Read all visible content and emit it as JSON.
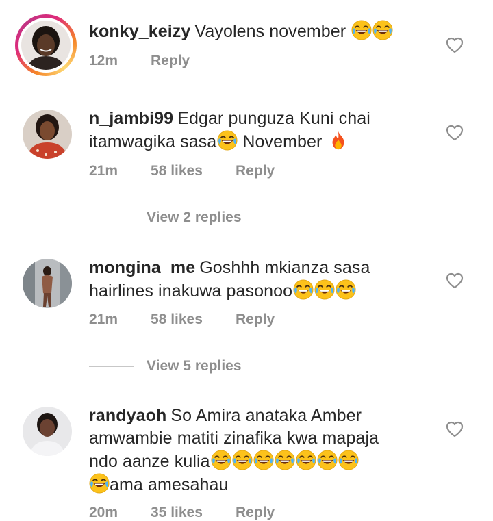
{
  "comments": [
    {
      "username": "konky_keizy",
      "text": "Vayolens november",
      "time": "12m",
      "likes": "",
      "reply_label": "Reply",
      "has_story": true
    },
    {
      "username": "n_jambi99",
      "text_line1": "Edgar punguza Kuni chai",
      "text_line2a": "itamwagika sasa",
      "text_line2b": "November",
      "time": "21m",
      "likes": "58 likes",
      "reply_label": "Reply",
      "view_replies": "View 2 replies"
    },
    {
      "username": "mongina_me",
      "text_line1": "Goshhh mkianza sasa",
      "text_line2": "hairlines inakuwa pasonoo",
      "time": "21m",
      "likes": "58 likes",
      "reply_label": "Reply",
      "view_replies": "View 5 replies"
    },
    {
      "username": "randyaoh",
      "text_line1": "So Amira anataka Amber",
      "text_line2": "amwambie matiti zinafika kwa mapaja",
      "text_line3": "ndo aanze kulia",
      "text_line4": "ama amesahau",
      "time": "20m",
      "likes": "35 likes",
      "reply_label": "Reply"
    }
  ],
  "icons": {
    "like": "heart-outline-icon",
    "laugh": "face-with-tears-of-joy-emoji",
    "fire": "fire-emoji"
  },
  "colors": {
    "text": "#262626",
    "secondary": "#8e8e8e",
    "story_ring_start": "#f58529",
    "story_ring_end": "#dd2a7b"
  }
}
